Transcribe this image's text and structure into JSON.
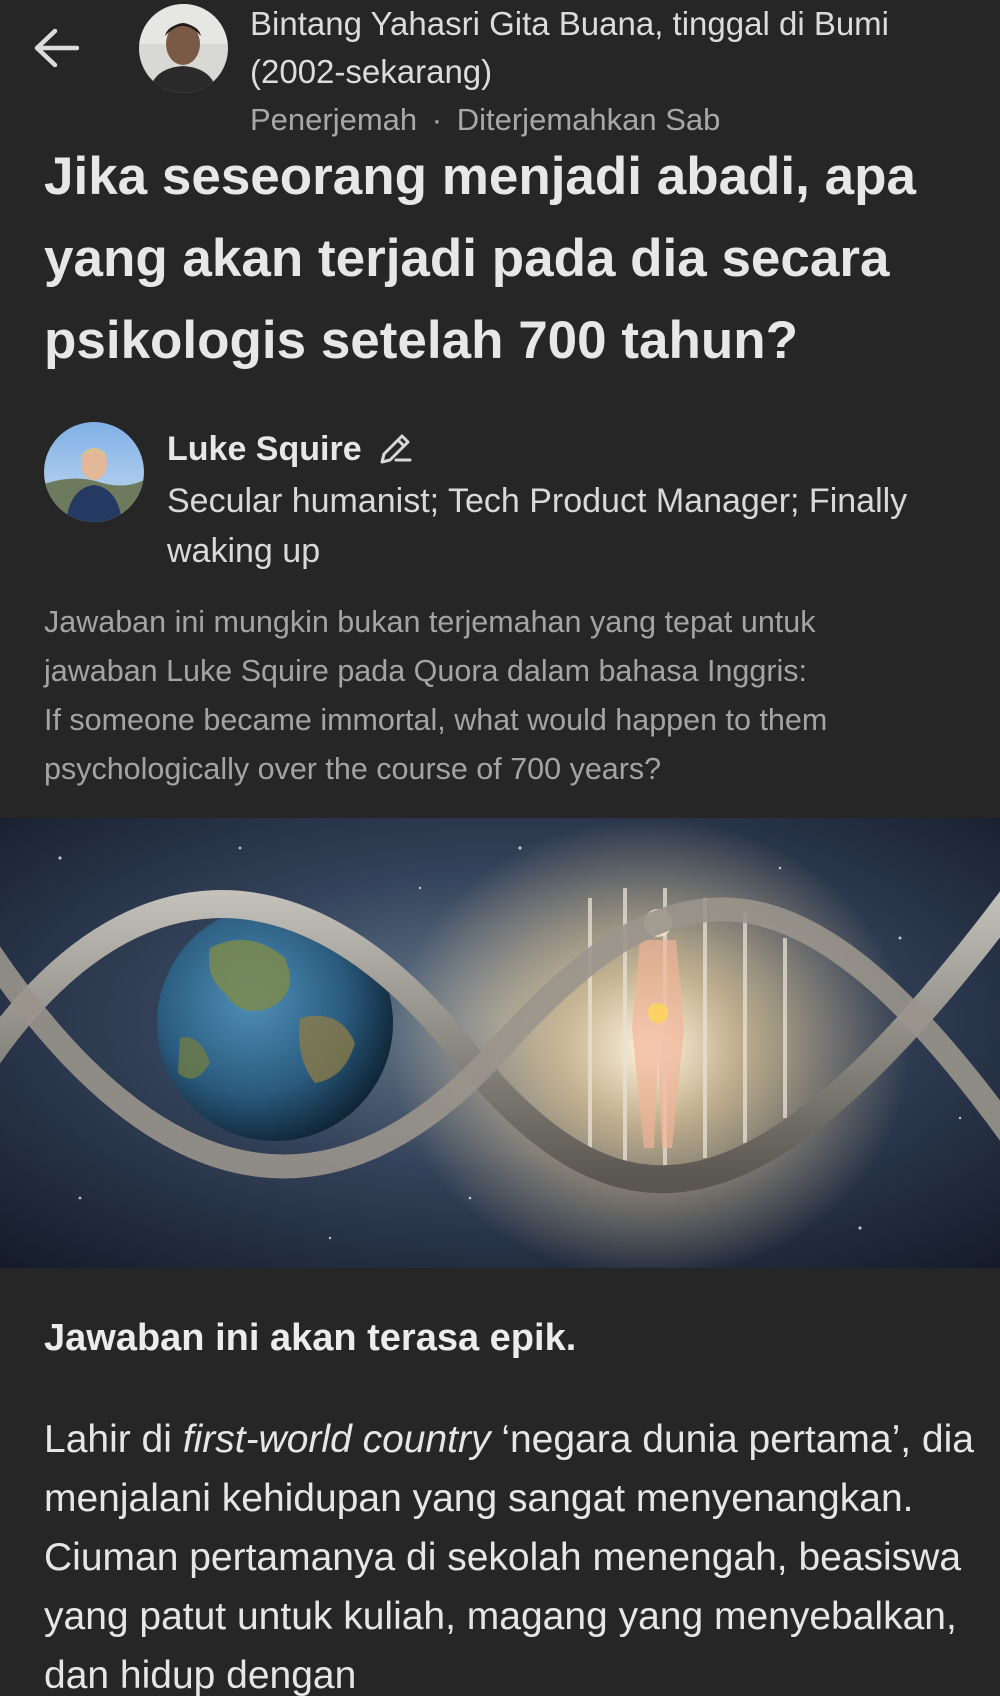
{
  "header": {
    "back_icon": "arrow-left-icon",
    "translator_name": "Bintang Yahasri Gita Buana, tinggal di Bumi (2002-sekarang)",
    "translator_role": "Penerjemah",
    "separator": "·",
    "translated_label": "Diterjemahkan Sab"
  },
  "question": {
    "title": "Jika seseorang menjadi abadi, apa yang akan terjadi pada dia secara psikologis setelah 700 tahun?"
  },
  "author": {
    "name": "Luke Squire",
    "badge_icon": "pen-icon",
    "bio": "Secular humanist; Tech Product Manager; Finally waking up"
  },
  "translation_note": {
    "line1": "Jawaban ini mungkin bukan terjemahan yang tepat untuk",
    "line2": "jawaban Luke Squire pada Quora dalam bahasa Inggris:",
    "original_question": "If someone became immortal, what would happen to them psychologically over the course of 700 years?"
  },
  "answer": {
    "lead": "Jawaban ini akan terasa epik.",
    "p1_before": "Lahir di ",
    "p1_italic": "first-world country",
    "p1_after": " ‘negara dunia pertama’, dia menjalani kehidupan yang sangat menyenangkan. Ciuman pertamanya di sekolah menengah, beasiswa yang patut untuk kuliah, magang yang menyebalkan, dan hidup dengan"
  },
  "colors": {
    "background": "#262627",
    "text_primary": "#e7e7e7",
    "text_secondary": "#a8a8a8"
  }
}
